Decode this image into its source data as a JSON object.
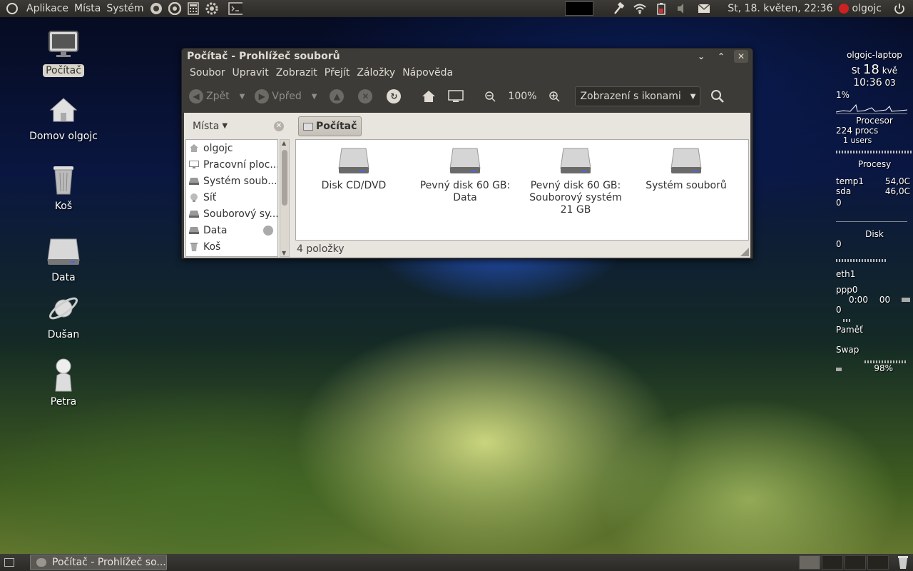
{
  "top_panel": {
    "menus": [
      "Aplikace",
      "Místa",
      "Systém"
    ],
    "clock": "St, 18. květen, 22:36",
    "user": "olgojc"
  },
  "desktop_icons": [
    {
      "label": "Počítač",
      "icon": "computer-icon",
      "selected": true
    },
    {
      "label": "Domov olgojc",
      "icon": "home-icon",
      "selected": false
    },
    {
      "label": "Koš",
      "icon": "trash-icon",
      "selected": false
    },
    {
      "label": "Data",
      "icon": "drive-icon",
      "selected": false
    },
    {
      "label": "Dušan",
      "icon": "planet-icon",
      "selected": false
    },
    {
      "label": "Petra",
      "icon": "person-icon",
      "selected": false
    }
  ],
  "window": {
    "title": "Počítač - Prohlížeč souborů",
    "menus": [
      "Soubor",
      "Upravit",
      "Zobrazit",
      "Přejít",
      "Záložky",
      "Nápověda"
    ],
    "toolbar": {
      "back_label": "Zpět",
      "forward_label": "Vpřed",
      "zoom": "100%",
      "view_mode": "Zobrazení s ikonami"
    },
    "sidebar": {
      "header": "Místa",
      "items": [
        {
          "label": "olgojc",
          "icon": "home-icon"
        },
        {
          "label": "Pracovní ploc...",
          "icon": "desktop-icon"
        },
        {
          "label": "Systém soub...",
          "icon": "drive-icon"
        },
        {
          "label": "Síť",
          "icon": "network-icon"
        },
        {
          "label": "Souborový sy...",
          "icon": "drive-icon"
        },
        {
          "label": "Data",
          "icon": "drive-icon"
        },
        {
          "label": "Koš",
          "icon": "trash-icon"
        }
      ]
    },
    "location_button": "Počítač",
    "files": [
      {
        "line1": "Disk CD/DVD",
        "line2": "",
        "line3": ""
      },
      {
        "line1": "Pevný disk 60 GB:",
        "line2": "Data",
        "line3": ""
      },
      {
        "line1": "Pevný disk 60 GB:",
        "line2": "Souborový systém",
        "line3": "21 GB"
      },
      {
        "line1": "Systém souborů",
        "line2": "",
        "line3": ""
      }
    ],
    "status": "4 položky"
  },
  "conky": {
    "hostname": "olgojc-laptop",
    "day": "St",
    "date_num": "18",
    "month": "kvě",
    "time": "10:36",
    "seconds": "03",
    "cpu_pct": "1%",
    "cpu_label": "Procesor",
    "procs": "224 procs",
    "users": "1 users",
    "procs_label": "Procesy",
    "temp_label": "temp1",
    "temp_val": "54,0C",
    "sda_label": "sda",
    "sda_val": "46,0C",
    "disk_zero": "0",
    "disk_label": "Disk",
    "disk_val": "0",
    "eth": "eth1",
    "ppp": "ppp0",
    "ppp_time": "0:00",
    "ppp_sec": "00",
    "ppp_val": "0",
    "mem_label": "Paměť",
    "swap_label": "Swap",
    "swap_pct": "98%"
  },
  "bottom_panel": {
    "task_label": "Počítač - Prohlížeč so..."
  }
}
